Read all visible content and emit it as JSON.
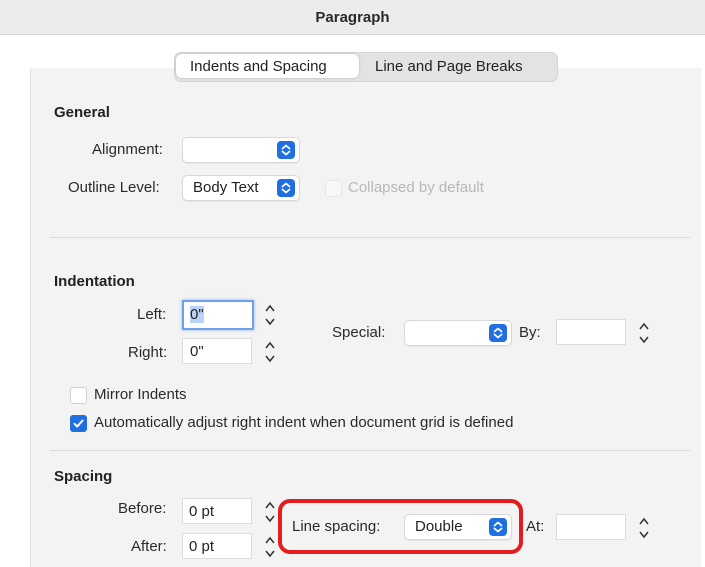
{
  "window": {
    "title": "Paragraph"
  },
  "tabs": [
    {
      "label": "Indents and Spacing",
      "selected": true
    },
    {
      "label": "Line and Page Breaks",
      "selected": false
    }
  ],
  "general": {
    "heading": "General",
    "alignment_label": "Alignment:",
    "alignment_value": "",
    "outline_label": "Outline Level:",
    "outline_value": "Body Text",
    "collapsed_label": "Collapsed by default",
    "collapsed_checked": false,
    "collapsed_enabled": false
  },
  "indentation": {
    "heading": "Indentation",
    "left_label": "Left:",
    "left_value": "0\"",
    "right_label": "Right:",
    "right_value": "0\"",
    "special_label": "Special:",
    "special_value": "",
    "by_label": "By:",
    "by_value": "",
    "mirror_label": "Mirror Indents",
    "mirror_checked": false,
    "auto_adjust_label": "Automatically adjust right indent when document grid is defined",
    "auto_adjust_checked": true
  },
  "spacing": {
    "heading": "Spacing",
    "before_label": "Before:",
    "before_value": "0 pt",
    "after_label": "After:",
    "after_value": "0 pt",
    "line_spacing_label": "Line spacing:",
    "line_spacing_value": "Double",
    "at_label": "At:",
    "at_value": ""
  },
  "colors": {
    "accent": "#1f6fe0",
    "highlight": "#e11d1d"
  }
}
